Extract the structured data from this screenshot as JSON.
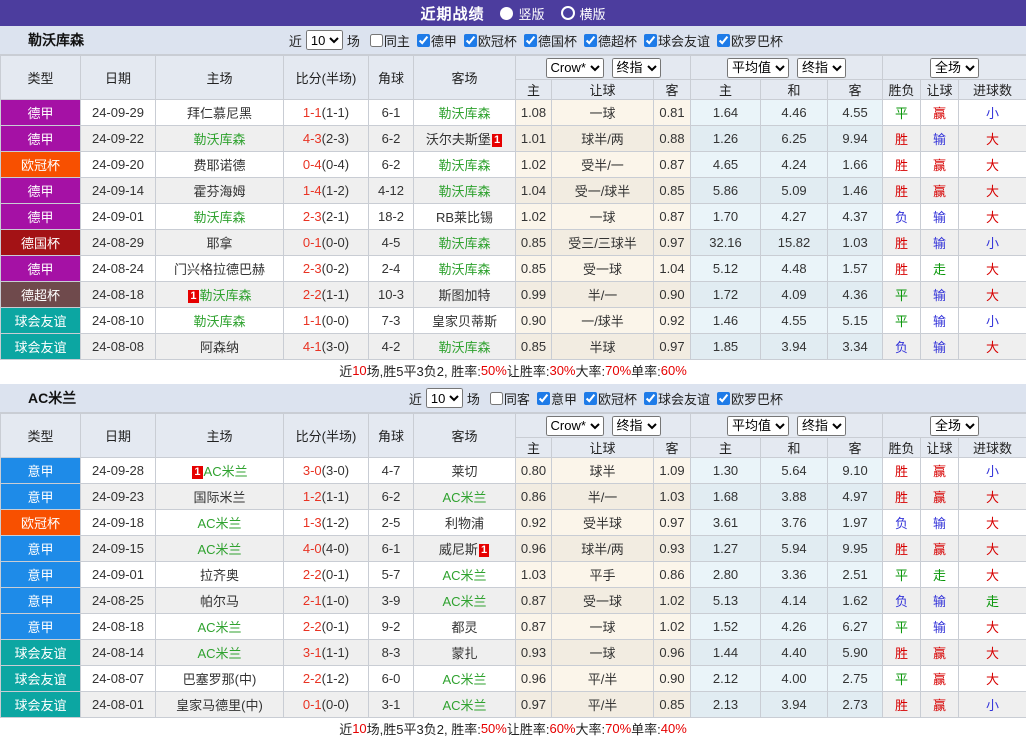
{
  "title_bar": {
    "title": "近期战绩",
    "vertical_label": "竖版",
    "horizontal_label": "横版",
    "selected": "竖版"
  },
  "league_colors": {
    "德甲": "#A511A5",
    "意甲": "#1E8BE8",
    "欧冠杯": "#F85000",
    "德国杯": "#A31215",
    "德超杯": "#6F4A4C",
    "球会友谊": "#0CA6A2"
  },
  "table_header": {
    "type": "类型",
    "date": "日期",
    "home": "主场",
    "score": "比分(半场)",
    "corner": "角球",
    "away": "客场",
    "crow": "Crow*",
    "final": "终指",
    "avg": "平均值",
    "full": "全场",
    "sub_home": "主",
    "sub_handicap": "让球",
    "sub_away": "客",
    "sub_avg_home": "主",
    "sub_avg_draw": "和",
    "sub_avg_away": "客",
    "sub_result": "胜负",
    "sub_let": "让球",
    "sub_goals": "进球数"
  },
  "sections": [
    {
      "team": "勒沃库森",
      "filters": {
        "near": "近",
        "rounds": "10",
        "unit": "场",
        "same_label": "同主",
        "same_checked": false,
        "leagues": [
          "德甲",
          "欧冠杯",
          "德国杯",
          "德超杯",
          "球会友谊",
          "欧罗巴杯"
        ]
      },
      "rows": [
        {
          "lg": "德甲",
          "date": "24-09-29",
          "home": "拜仁慕尼黑",
          "hg": false,
          "away": "勒沃库森",
          "ag": true,
          "ft": "1-1",
          "ht": "(1-1)",
          "cn": "6-1",
          "o1": "1.08",
          "hc": "一球",
          "o2": "0.81",
          "m1": "1.64",
          "m2": "4.46",
          "m3": "4.55",
          "rs": [
            "平",
            "g"
          ],
          "hs": [
            "赢",
            "r"
          ],
          "gs": [
            "小",
            "b"
          ]
        },
        {
          "lg": "德甲",
          "date": "24-09-22",
          "home": "勒沃库森",
          "hg": true,
          "away": "沃尔夫斯堡",
          "ag": false,
          "abadge": "1",
          "ft": "4-3",
          "ht": "(2-3)",
          "cn": "6-2",
          "o1": "1.01",
          "hc": "球半/两",
          "o2": "0.88",
          "m1": "1.26",
          "m2": "6.25",
          "m3": "9.94",
          "rs": [
            "胜",
            "r"
          ],
          "hs": [
            "输",
            "b"
          ],
          "gs": [
            "大",
            "r"
          ]
        },
        {
          "lg": "欧冠杯",
          "date": "24-09-20",
          "home": "费耶诺德",
          "hg": false,
          "away": "勒沃库森",
          "ag": true,
          "ft": "0-4",
          "ht": "(0-4)",
          "cn": "6-2",
          "o1": "1.02",
          "hc": "受半/一",
          "o2": "0.87",
          "m1": "4.65",
          "m2": "4.24",
          "m3": "1.66",
          "rs": [
            "胜",
            "r"
          ],
          "hs": [
            "赢",
            "r"
          ],
          "gs": [
            "大",
            "r"
          ]
        },
        {
          "lg": "德甲",
          "date": "24-09-14",
          "home": "霍芬海姆",
          "hg": false,
          "away": "勒沃库森",
          "ag": true,
          "ft": "1-4",
          "ht": "(1-2)",
          "cn": "4-12",
          "o1": "1.04",
          "hc": "受一/球半",
          "o2": "0.85",
          "m1": "5.86",
          "m2": "5.09",
          "m3": "1.46",
          "rs": [
            "胜",
            "r"
          ],
          "hs": [
            "赢",
            "r"
          ],
          "gs": [
            "大",
            "r"
          ]
        },
        {
          "lg": "德甲",
          "date": "24-09-01",
          "home": "勒沃库森",
          "hg": true,
          "away": "RB莱比锡",
          "ag": false,
          "ft": "2-3",
          "ht": "(2-1)",
          "cn": "18-2",
          "o1": "1.02",
          "hc": "一球",
          "o2": "0.87",
          "m1": "1.70",
          "m2": "4.27",
          "m3": "4.37",
          "rs": [
            "负",
            "b"
          ],
          "hs": [
            "输",
            "b"
          ],
          "gs": [
            "大",
            "r"
          ]
        },
        {
          "lg": "德国杯",
          "date": "24-08-29",
          "home": "耶拿",
          "hg": false,
          "away": "勒沃库森",
          "ag": true,
          "ft": "0-1",
          "ht": "(0-0)",
          "cn": "4-5",
          "o1": "0.85",
          "hc": "受三/三球半",
          "o2": "0.97",
          "m1": "32.16",
          "m2": "15.82",
          "m3": "1.03",
          "rs": [
            "胜",
            "r"
          ],
          "hs": [
            "输",
            "b"
          ],
          "gs": [
            "小",
            "b"
          ]
        },
        {
          "lg": "德甲",
          "date": "24-08-24",
          "home": "门兴格拉德巴赫",
          "hg": false,
          "away": "勒沃库森",
          "ag": true,
          "ft": "2-3",
          "ht": "(0-2)",
          "cn": "2-4",
          "o1": "0.85",
          "hc": "受一球",
          "o2": "1.04",
          "m1": "5.12",
          "m2": "4.48",
          "m3": "1.57",
          "rs": [
            "胜",
            "r"
          ],
          "hs": [
            "走",
            "g"
          ],
          "gs": [
            "大",
            "r"
          ]
        },
        {
          "lg": "德超杯",
          "date": "24-08-18",
          "home": "勒沃库森",
          "hg": true,
          "hbadge": "1",
          "away": "斯图加特",
          "ag": false,
          "ft": "2-2",
          "ht": "(1-1)",
          "cn": "10-3",
          "o1": "0.99",
          "hc": "半/一",
          "o2": "0.90",
          "m1": "1.72",
          "m2": "4.09",
          "m3": "4.36",
          "rs": [
            "平",
            "g"
          ],
          "hs": [
            "输",
            "b"
          ],
          "gs": [
            "大",
            "r"
          ]
        },
        {
          "lg": "球会友谊",
          "date": "24-08-10",
          "home": "勒沃库森",
          "hg": true,
          "away": "皇家贝蒂斯",
          "ag": false,
          "ft": "1-1",
          "ht": "(0-0)",
          "cn": "7-3",
          "o1": "0.90",
          "hc": "一/球半",
          "o2": "0.92",
          "m1": "1.46",
          "m2": "4.55",
          "m3": "5.15",
          "rs": [
            "平",
            "g"
          ],
          "hs": [
            "输",
            "b"
          ],
          "gs": [
            "小",
            "b"
          ]
        },
        {
          "lg": "球会友谊",
          "date": "24-08-08",
          "home": "阿森纳",
          "hg": false,
          "away": "勒沃库森",
          "ag": true,
          "ft": "4-1",
          "ht": "(3-0)",
          "cn": "4-2",
          "o1": "0.85",
          "hc": "半球",
          "o2": "0.97",
          "m1": "1.85",
          "m2": "3.94",
          "m3": "3.34",
          "rs": [
            "负",
            "b"
          ],
          "hs": [
            "输",
            "b"
          ],
          "gs": [
            "大",
            "r"
          ]
        }
      ],
      "summary": [
        {
          "t": "近"
        },
        {
          "t": "10",
          "red": true
        },
        {
          "t": "场,胜5平3负2, 胜率:"
        },
        {
          "t": "50%",
          "red": true
        },
        {
          "t": " 让胜率:"
        },
        {
          "t": "30%",
          "red": true
        },
        {
          "t": " 大率:"
        },
        {
          "t": "70%",
          "red": true
        },
        {
          "t": " 单率:"
        },
        {
          "t": "60%",
          "red": true
        }
      ]
    },
    {
      "team": "AC米兰",
      "filters": {
        "near": "近",
        "rounds": "10",
        "unit": "场",
        "same_label": "同客",
        "same_checked": false,
        "leagues": [
          "意甲",
          "欧冠杯",
          "球会友谊",
          "欧罗巴杯"
        ]
      },
      "rows": [
        {
          "lg": "意甲",
          "date": "24-09-28",
          "home": "AC米兰",
          "hg": true,
          "hbadge": "1",
          "away": "莱切",
          "ag": false,
          "ft": "3-0",
          "ht": "(3-0)",
          "cn": "4-7",
          "o1": "0.80",
          "hc": "球半",
          "o2": "1.09",
          "m1": "1.30",
          "m2": "5.64",
          "m3": "9.10",
          "rs": [
            "胜",
            "r"
          ],
          "hs": [
            "赢",
            "r"
          ],
          "gs": [
            "小",
            "b"
          ]
        },
        {
          "lg": "意甲",
          "date": "24-09-23",
          "home": "国际米兰",
          "hg": false,
          "away": "AC米兰",
          "ag": true,
          "ft": "1-2",
          "ht": "(1-1)",
          "cn": "6-2",
          "o1": "0.86",
          "hc": "半/一",
          "o2": "1.03",
          "m1": "1.68",
          "m2": "3.88",
          "m3": "4.97",
          "rs": [
            "胜",
            "r"
          ],
          "hs": [
            "赢",
            "r"
          ],
          "gs": [
            "大",
            "r"
          ]
        },
        {
          "lg": "欧冠杯",
          "date": "24-09-18",
          "home": "AC米兰",
          "hg": true,
          "away": "利物浦",
          "ag": false,
          "ft": "1-3",
          "ht": "(1-2)",
          "cn": "2-5",
          "o1": "0.92",
          "hc": "受半球",
          "o2": "0.97",
          "m1": "3.61",
          "m2": "3.76",
          "m3": "1.97",
          "rs": [
            "负",
            "b"
          ],
          "hs": [
            "输",
            "b"
          ],
          "gs": [
            "大",
            "r"
          ]
        },
        {
          "lg": "意甲",
          "date": "24-09-15",
          "home": "AC米兰",
          "hg": true,
          "away": "威尼斯",
          "ag": false,
          "abadge": "1",
          "ft": "4-0",
          "ht": "(4-0)",
          "cn": "6-1",
          "o1": "0.96",
          "hc": "球半/两",
          "o2": "0.93",
          "m1": "1.27",
          "m2": "5.94",
          "m3": "9.95",
          "rs": [
            "胜",
            "r"
          ],
          "hs": [
            "赢",
            "r"
          ],
          "gs": [
            "大",
            "r"
          ]
        },
        {
          "lg": "意甲",
          "date": "24-09-01",
          "home": "拉齐奥",
          "hg": false,
          "away": "AC米兰",
          "ag": true,
          "ft": "2-2",
          "ht": "(0-1)",
          "cn": "5-7",
          "o1": "1.03",
          "hc": "平手",
          "o2": "0.86",
          "m1": "2.80",
          "m2": "3.36",
          "m3": "2.51",
          "rs": [
            "平",
            "g"
          ],
          "hs": [
            "走",
            "g"
          ],
          "gs": [
            "大",
            "r"
          ]
        },
        {
          "lg": "意甲",
          "date": "24-08-25",
          "home": "帕尔马",
          "hg": false,
          "away": "AC米兰",
          "ag": true,
          "ft": "2-1",
          "ht": "(1-0)",
          "cn": "3-9",
          "o1": "0.87",
          "hc": "受一球",
          "o2": "1.02",
          "m1": "5.13",
          "m2": "4.14",
          "m3": "1.62",
          "rs": [
            "负",
            "b"
          ],
          "hs": [
            "输",
            "b"
          ],
          "gs": [
            "走",
            "g"
          ]
        },
        {
          "lg": "意甲",
          "date": "24-08-18",
          "home": "AC米兰",
          "hg": true,
          "away": "都灵",
          "ag": false,
          "ft": "2-2",
          "ht": "(0-1)",
          "cn": "9-2",
          "o1": "0.87",
          "hc": "一球",
          "o2": "1.02",
          "m1": "1.52",
          "m2": "4.26",
          "m3": "6.27",
          "rs": [
            "平",
            "g"
          ],
          "hs": [
            "输",
            "b"
          ],
          "gs": [
            "大",
            "r"
          ]
        },
        {
          "lg": "球会友谊",
          "date": "24-08-14",
          "home": "AC米兰",
          "hg": true,
          "away": "蒙扎",
          "ag": false,
          "ft": "3-1",
          "ht": "(1-1)",
          "cn": "8-3",
          "o1": "0.93",
          "hc": "一球",
          "o2": "0.96",
          "m1": "1.44",
          "m2": "4.40",
          "m3": "5.90",
          "rs": [
            "胜",
            "r"
          ],
          "hs": [
            "赢",
            "r"
          ],
          "gs": [
            "大",
            "r"
          ]
        },
        {
          "lg": "球会友谊",
          "date": "24-08-07",
          "home": "巴塞罗那(中)",
          "hg": false,
          "away": "AC米兰",
          "ag": true,
          "ft": "2-2",
          "ht": "(1-2)",
          "cn": "6-0",
          "o1": "0.96",
          "hc": "平/半",
          "o2": "0.90",
          "m1": "2.12",
          "m2": "4.00",
          "m3": "2.75",
          "rs": [
            "平",
            "g"
          ],
          "hs": [
            "赢",
            "r"
          ],
          "gs": [
            "大",
            "r"
          ]
        },
        {
          "lg": "球会友谊",
          "date": "24-08-01",
          "home": "皇家马德里(中)",
          "hg": false,
          "away": "AC米兰",
          "ag": true,
          "ft": "0-1",
          "ht": "(0-0)",
          "cn": "3-1",
          "o1": "0.97",
          "hc": "平/半",
          "o2": "0.85",
          "m1": "2.13",
          "m2": "3.94",
          "m3": "2.73",
          "rs": [
            "胜",
            "r"
          ],
          "hs": [
            "赢",
            "r"
          ],
          "gs": [
            "小",
            "b"
          ]
        }
      ],
      "summary": [
        {
          "t": "近"
        },
        {
          "t": "10",
          "red": true
        },
        {
          "t": "场,胜5平3负2, 胜率:"
        },
        {
          "t": "50%",
          "red": true
        },
        {
          "t": " 让胜率:"
        },
        {
          "t": "60%",
          "red": true
        },
        {
          "t": " 大率:"
        },
        {
          "t": "70%",
          "red": true
        },
        {
          "t": " 单率:"
        },
        {
          "t": "40%",
          "red": true
        }
      ]
    }
  ]
}
